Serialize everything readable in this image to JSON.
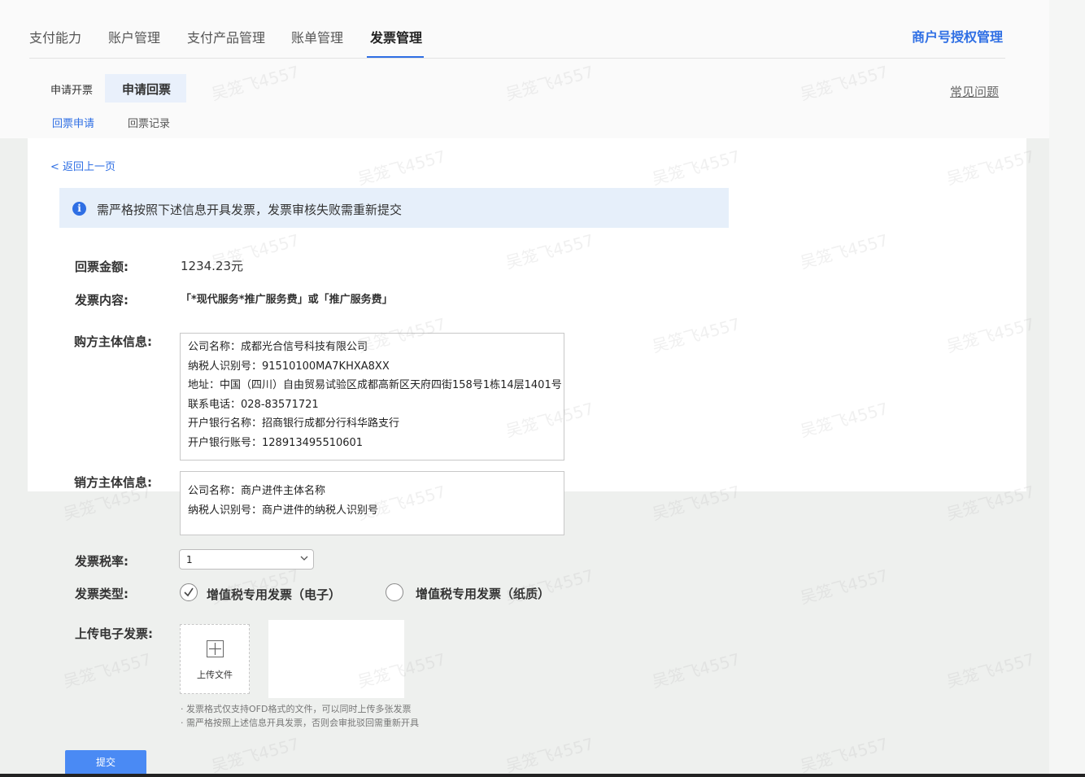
{
  "nav": {
    "tabs": [
      {
        "label": "支付能力"
      },
      {
        "label": "账户管理"
      },
      {
        "label": "支付产品管理"
      },
      {
        "label": "账单管理"
      },
      {
        "label": "发票管理"
      }
    ],
    "active_tab": "发票管理",
    "right_link": "商户号授权管理"
  },
  "subtabs": [
    {
      "label": "申请开票"
    },
    {
      "label": "申请回票"
    }
  ],
  "subsub_tabs": [
    {
      "label": "回票申请"
    },
    {
      "label": "回票记录"
    }
  ],
  "faq": "常见问题",
  "back_link": "< 返回上一页",
  "notice": {
    "icon": "info-icon",
    "text": "需严格按照下述信息开具发票，发票审核失败需重新提交"
  },
  "form": {
    "amount": {
      "label": "回票金额:",
      "value": "1234.23元"
    },
    "content": {
      "label": "发票内容:",
      "value": "「*现代服务*推广服务费」或「推广服务费」"
    },
    "buyer": {
      "label": "购方主体信息:",
      "lines": [
        "公司名称：成都光合信号科技有限公司",
        "纳税人识别号：91510100MA7KHXA8XX",
        "地址：中国（四川）自由贸易试验区成都高新区天府四街158号1栋14层1401号",
        "联系电话：028-83571721",
        "开户银行名称：招商银行成都分行科华路支行",
        "开户银行账号：128913495510601"
      ]
    },
    "seller": {
      "label": "销方主体信息:",
      "lines": [
        "公司名称：商户进件主体名称",
        "纳税人识别号：商户进件的纳税人识别号"
      ]
    },
    "tax_rate": {
      "label": "发票税率:",
      "value": "1"
    },
    "invoice_type": {
      "label": "发票类型:",
      "options": [
        {
          "label": "增值税专用发票（电子）",
          "checked": true
        },
        {
          "label": "增值税专用发票（纸质）",
          "checked": false
        }
      ]
    },
    "upload": {
      "label": "上传电子发票:",
      "button_label": "上传文件",
      "hints": [
        "· 发票格式仅支持OFD格式的文件，可以同时上传多张发票",
        "· 需严格按照上述信息开具发票，否则会审批驳回需重新开具"
      ]
    },
    "submit_label": "提交"
  },
  "watermark": "吴笼飞4557",
  "colors": {
    "accent": "#2f6fe4",
    "notice_bg": "#e6effa",
    "submit": "#4a8af4"
  }
}
